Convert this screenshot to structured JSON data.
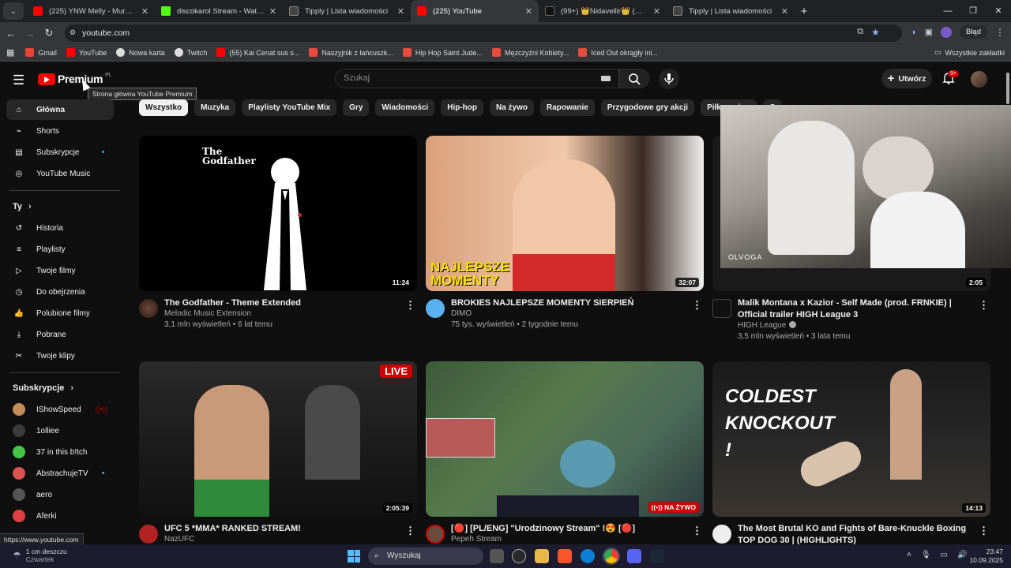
{
  "browser": {
    "tabs": [
      {
        "title": "(225) YNW Melly - Murder On M",
        "color": "#ff0000"
      },
      {
        "title": "discokarol Stream - Watch Live",
        "color": "#53fc18"
      },
      {
        "title": "Tipply | Lista wiadomości",
        "color": "#ffffff"
      },
      {
        "title": "(225) YouTube",
        "color": "#ff0000"
      },
      {
        "title": "(99+) 👑Nidavellir👑 (@nidave",
        "color": "#111111"
      },
      {
        "title": "Tipply | Lista wiadomości",
        "color": "#ffffff"
      }
    ],
    "url": "youtube.com",
    "profile_label": "Błąd",
    "bookmarks": [
      {
        "label": "Gmail",
        "color": "#ea4335"
      },
      {
        "label": "YouTube",
        "color": "#ff0000"
      },
      {
        "label": "Nowa karta",
        "color": "#dddddd"
      },
      {
        "label": "Twitch",
        "color": "#dddddd"
      },
      {
        "label": "(55) Kai Cenat sus s...",
        "color": "#ff0000"
      },
      {
        "label": "Naszyjnik z łańcuszk...",
        "color": "#e74c3c"
      },
      {
        "label": "Hip Hop Saint Jude...",
        "color": "#e74c3c"
      },
      {
        "label": "Męzczyźni Kobiety...",
        "color": "#e74c3c"
      },
      {
        "label": "Iced Out okrągły ini...",
        "color": "#e74c3c"
      }
    ],
    "all_bookmarks": "Wszystkie zakładki",
    "status_url": "https://www.youtube.com"
  },
  "yt": {
    "logo_text": "Premium",
    "logo_region": "PL",
    "tooltip": "Strona główna YouTube Premium",
    "search_placeholder": "Szukaj",
    "create_label": "Utwórz",
    "notif_count": "9+",
    "sidebar": {
      "main": [
        {
          "label": "Główna",
          "icon": "home-icon"
        },
        {
          "label": "Shorts",
          "icon": "shorts-icon"
        },
        {
          "label": "Subskrypcje",
          "icon": "subscriptions-icon"
        },
        {
          "label": "YouTube Music",
          "icon": "music-icon"
        }
      ],
      "you_header": "Ty",
      "you": [
        {
          "label": "Historia",
          "icon": "history-icon"
        },
        {
          "label": "Playlisty",
          "icon": "playlists-icon"
        },
        {
          "label": "Twoje filmy",
          "icon": "your-videos-icon"
        },
        {
          "label": "Do obejrzenia",
          "icon": "watch-later-icon"
        },
        {
          "label": "Polubione filmy",
          "icon": "liked-icon"
        },
        {
          "label": "Pobrane",
          "icon": "download-icon"
        },
        {
          "label": "Twoje klipy",
          "icon": "clips-icon"
        }
      ],
      "subs_header": "Subskrypcje",
      "subs": [
        {
          "label": "IShowSpeed",
          "color": "#c48a5a"
        },
        {
          "label": "1olliee",
          "color": "#3b3b3b"
        },
        {
          "label": "37 in this b!tch",
          "color": "#44c744"
        },
        {
          "label": "AbstrachujeTV",
          "color": "#d9534f"
        },
        {
          "label": "aero",
          "color": "#555555"
        },
        {
          "label": "Aferki",
          "color": "#e04040"
        }
      ]
    },
    "chips": [
      "Wszystko",
      "Muzyka",
      "Playlisty YouTube Mix",
      "Gry",
      "Wiadomości",
      "Hip-hop",
      "Na żywo",
      "Rapowanie",
      "Przygodowe gry akcji",
      "Piłka nożna"
    ],
    "chip_partial": "O",
    "videos": [
      {
        "title": "The Godfather - Theme Extended",
        "channel": "Melodic Music Extension",
        "stats": "3,1 mln wyświetleń • 6 lat temu",
        "duration": "11:24",
        "thumb_text": "The Godfather"
      },
      {
        "title": "BROKIES NAJLEPSZE MOMENTY SIERPIEŃ",
        "channel": "DIMO",
        "stats": "75 tys. wyświetleń • 2 tygodnie temu",
        "duration": "32:07",
        "thumb_text": "NAJLEPSZE MOMENTY"
      },
      {
        "title": "Malik Montana x Kazior - Self Made (prod. FRNKIE) | Official trailer HIGH League 3",
        "channel": "HIGH League",
        "stats": "3,5 mln wyświetleń • 3 lata temu",
        "duration": "2:05",
        "thumb_text": "OLVOGA"
      },
      {
        "title": "UFC 5 *MMA* RANKED STREAM!",
        "channel": "NazUFC",
        "duration": "2:05:39",
        "live": "LIVE"
      },
      {
        "title": "[🔴] [PL/ENG] \"Urodzinowy Stream\" !😍 [🔴]",
        "channel": "Pepeh Stream",
        "live": "NA ŻYWO"
      },
      {
        "title": "The Most Brutal KO and Fights of Bare-Knuckle Boxing TOP DOG 30 | (HIGHLIGHTS)",
        "duration": "14:13",
        "thumb_text": "COLDEST KNOCKOUT !"
      }
    ]
  },
  "taskbar": {
    "weather_temp": "1 cm deszczu",
    "weather_day": "Czwartek",
    "search": "Wyszukaj",
    "time": "23:47",
    "date": "10.09.2025"
  }
}
